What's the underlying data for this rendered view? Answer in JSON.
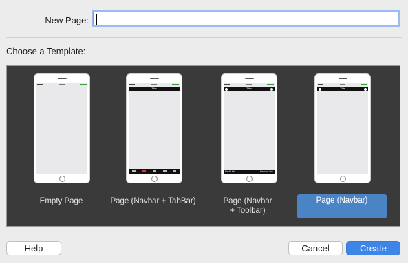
{
  "form": {
    "name_label": "New Page:",
    "name_value": "",
    "template_label": "Choose a Template:"
  },
  "templates": [
    {
      "label": "Empty Page",
      "selected": false
    },
    {
      "label": "Page (Navbar + TabBar)",
      "navbar_title": "Title",
      "selected": false
    },
    {
      "label": "Page (Navbar + Toolbar)",
      "label_line1": "Page (Navbar",
      "label_line2": "+ Toolbar)",
      "navbar_title": "Title",
      "toolbar_left": "First Link",
      "toolbar_right": "Second Link",
      "selected": false
    },
    {
      "label": "Page (Navbar)",
      "navbar_title": "Title",
      "selected": true
    }
  ],
  "buttons": {
    "help": "Help",
    "cancel": "Cancel",
    "create": "Create"
  },
  "colors": {
    "accent": "#3d86e8",
    "selection": "#4a84c4",
    "gallery_bg": "#3a3a3a",
    "navbar": "#111111"
  }
}
